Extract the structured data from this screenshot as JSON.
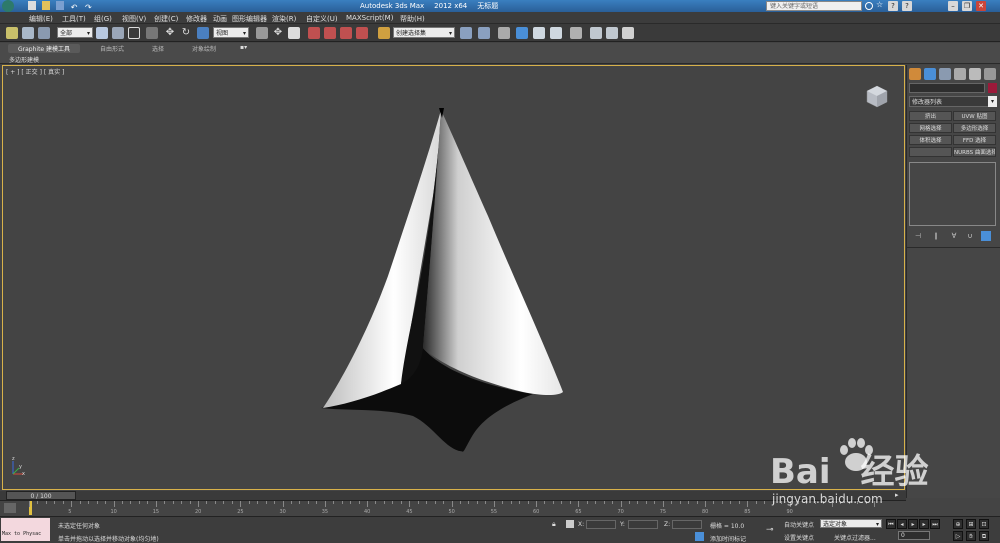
{
  "titlebar": {
    "app": "Autodesk 3ds Max",
    "version": "2012 x64",
    "doc": "无标题",
    "search_placeholder": "键入关键字或短语",
    "minimize": "–",
    "restore": "❐",
    "close": "✕",
    "help": "?"
  },
  "menu": [
    "编辑(E)",
    "工具(T)",
    "组(G)",
    "视图(V)",
    "创建(C)",
    "修改器",
    "动画",
    "图形编辑器",
    "渲染(R)",
    "自定义(U)",
    "MAXScript(M)",
    "帮助(H)"
  ],
  "toolbar": {
    "selection_filter": "全部",
    "coord_system": "视图",
    "named_selection": "创建选择集"
  },
  "ribbon": {
    "tabs": [
      "Graphite 建模工具",
      "自由形式",
      "选择",
      "对象绘制"
    ],
    "sub_label": "多边形建模"
  },
  "viewport": {
    "label": "[ + ] [ 正交 ] [ 真实 ]",
    "axis_x": "x",
    "axis_y": "y",
    "axis_z": "z"
  },
  "command_panel": {
    "modifier_list": "修改器列表",
    "buttons": [
      "挤出",
      "UVW 贴图",
      "网格选择",
      "多边形选择",
      "体积选择",
      "FFD 选择",
      "",
      "NURBS 曲面选择"
    ]
  },
  "timeslider": {
    "label": "0 / 100"
  },
  "timeline": {
    "ticks": [
      "5",
      "10",
      "15",
      "20",
      "25",
      "30",
      "35",
      "40",
      "45",
      "50",
      "55",
      "60",
      "65",
      "70",
      "75",
      "80",
      "85",
      "90"
    ]
  },
  "status": {
    "maxscript": "Max to Physac",
    "line1": "未选定任何对象",
    "line2": "单击并拖动以选择并移动对象(均匀地)",
    "x_label": "X:",
    "y_label": "Y:",
    "z_label": "Z:",
    "grid": "栅格 = 10.0",
    "add_time_tag": "添加时间标记",
    "auto_key": "自动关键点",
    "set_key": "设置关键点",
    "selected_objects": "选定对象",
    "key_filters": "关键点过滤器...",
    "frame": "0"
  },
  "watermark": {
    "brand": "Bai",
    "brand_after": "经验",
    "url": "jingyan.baidu.com"
  },
  "colors": {
    "accent": "#3a7fc0",
    "viewport_border": "#d8b24a",
    "viewport_bg": "#444444"
  }
}
